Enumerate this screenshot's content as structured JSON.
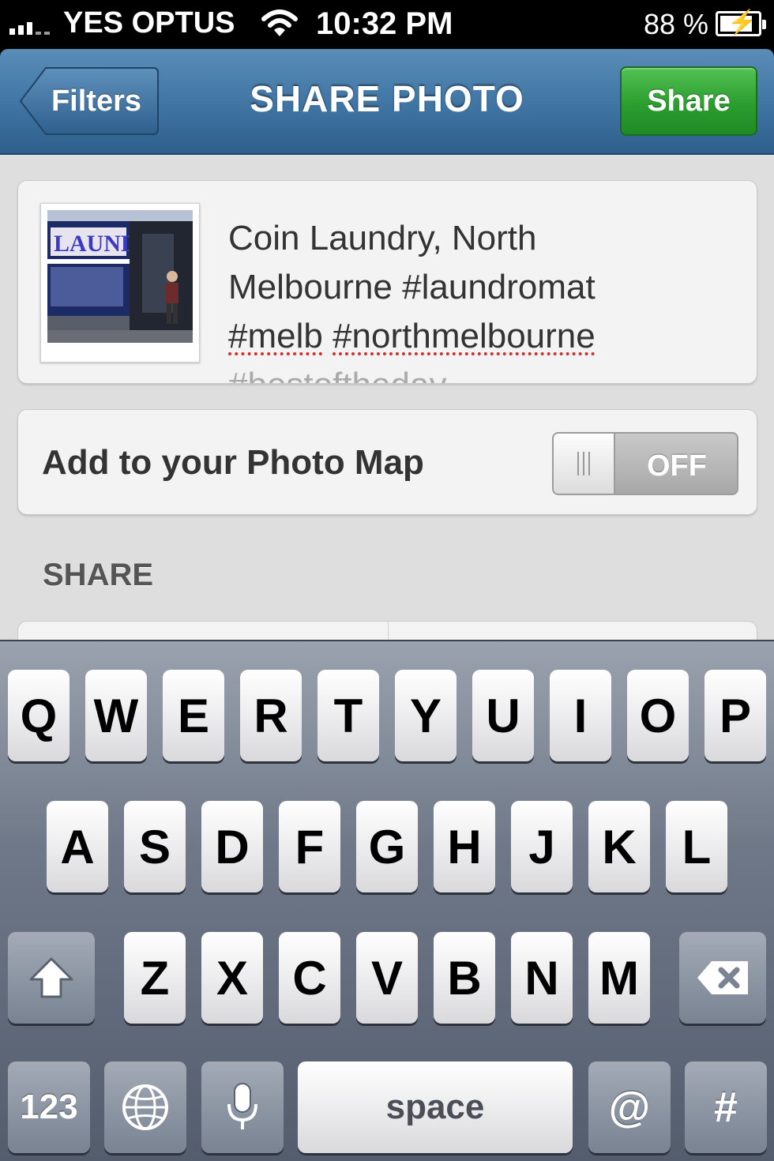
{
  "status_bar": {
    "carrier": "YES OPTUS",
    "time": "10:32 PM",
    "battery_percent": "88 %",
    "battery_level": 0.88,
    "icons": [
      "signal-icon",
      "wifi-icon",
      "battery-icon"
    ]
  },
  "nav": {
    "back_label": "Filters",
    "title": "SHARE PHOTO",
    "share_label": "Share"
  },
  "caption": {
    "line1": "Coin Laundry, North",
    "line2": "Melbourne #laundromat",
    "line3_a": "#melb",
    "line3_b": "#northmelbourne",
    "line4": "#bestoftheday"
  },
  "photo_map": {
    "label": "Add to your Photo Map",
    "toggle_state": "OFF"
  },
  "share_section": {
    "header": "SHARE"
  },
  "keyboard": {
    "row1": [
      "Q",
      "W",
      "E",
      "R",
      "T",
      "Y",
      "U",
      "I",
      "O",
      "P"
    ],
    "row2": [
      "A",
      "S",
      "D",
      "F",
      "G",
      "H",
      "J",
      "K",
      "L"
    ],
    "row3": [
      "Z",
      "X",
      "C",
      "V",
      "B",
      "N",
      "M"
    ],
    "numbers_label": "123",
    "space_label": "space",
    "at_label": "@",
    "hash_label": "#"
  },
  "colors": {
    "nav_blue": "#3f74a3",
    "share_green": "#2b9e2f",
    "background": "#dedede"
  }
}
